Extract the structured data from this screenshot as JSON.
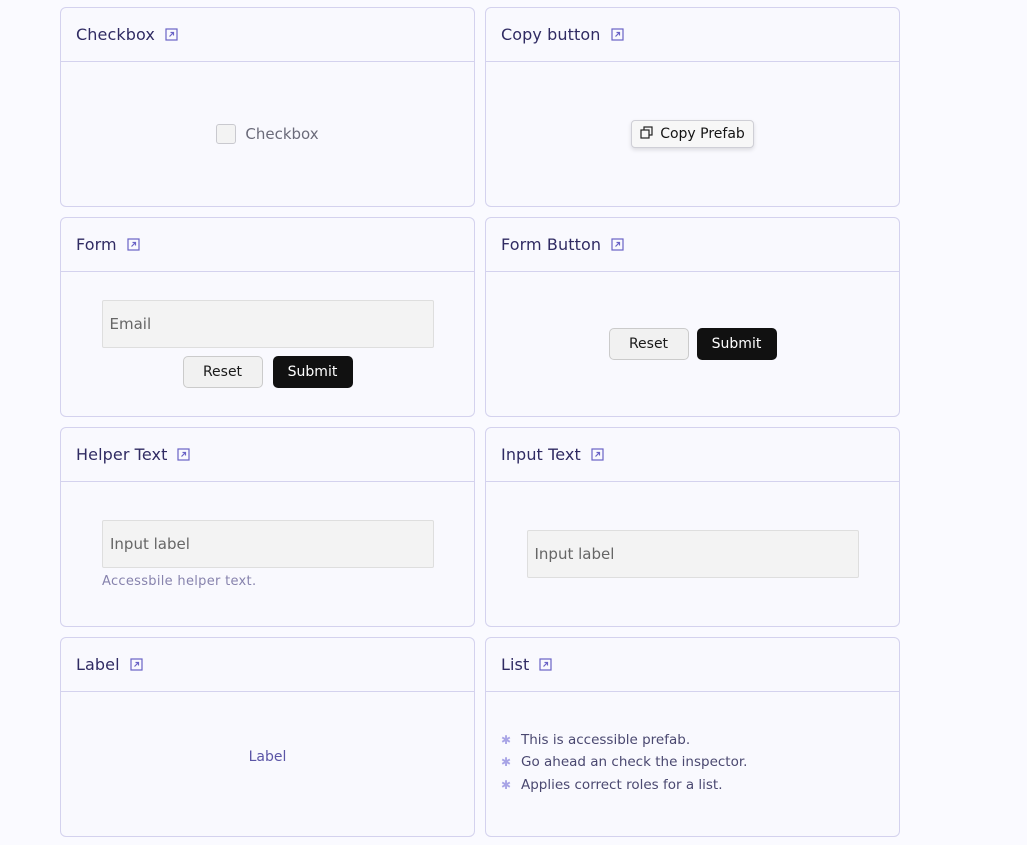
{
  "cards": {
    "checkbox": {
      "title": "Checkbox",
      "label": "Checkbox"
    },
    "copy": {
      "title": "Copy button",
      "button_label": "Copy Prefab"
    },
    "form": {
      "title": "Form",
      "email_placeholder": "Email",
      "reset_label": "Reset",
      "submit_label": "Submit"
    },
    "form_button": {
      "title": "Form Button",
      "reset_label": "Reset",
      "submit_label": "Submit"
    },
    "helper_text": {
      "title": "Helper Text",
      "input_label": "Input label",
      "helper": "Accessbile helper text."
    },
    "input_text": {
      "title": "Input Text",
      "input_label": "Input label"
    },
    "label": {
      "title": "Label",
      "text": "Label"
    },
    "list": {
      "title": "List",
      "items": [
        "This is accessible prefab.",
        "Go ahead an check the inspector.",
        "Applies correct roles for a list."
      ]
    }
  },
  "icons": {
    "external_link": "external-link-icon",
    "copy": "copy-icon",
    "bullet": "bullet-icon"
  },
  "colors": {
    "border": "#d4d2ee",
    "title": "#302b63",
    "submit_bg": "#111111",
    "accent": "#5b55a6"
  }
}
